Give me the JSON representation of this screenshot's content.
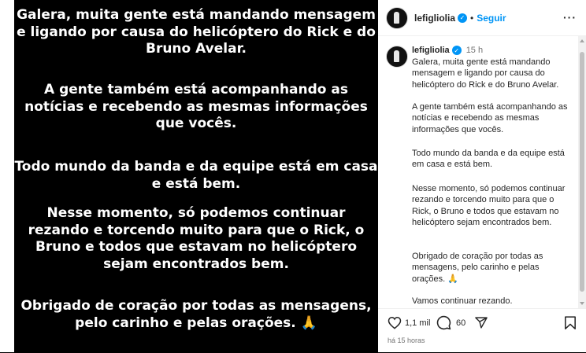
{
  "story": {
    "paragraphs": [
      "Galera, muita gente está mandando mensagem e ligando por causa do helicóptero do Rick e do Bruno Avelar.",
      "A gente também está acompanhando as notícias e recebendo as mesmas informações que vocês.",
      "Todo mundo da banda e da equipe está em casa e está bem.",
      "Nesse momento, só podemos continuar rezando e torcendo muito para que o Rick, o Bruno e todos que estavam no helicóptero sejam encontrados bem.",
      "Obrigado de coração por todas as mensagens, pelo carinho e pelas orações. 🙏"
    ]
  },
  "post": {
    "username": "lefigliolia",
    "follow_label": "Seguir",
    "separator": "•",
    "more_label": "···",
    "caption_time": "15 h",
    "caption": [
      "Galera, muita gente está mandando mensagem e ligando por causa do helicóptero do Rick e do Bruno Avelar.",
      "A gente também está acompanhando as notícias e recebendo as mesmas informações que vocês.",
      "Todo mundo da banda e da equipe está em casa e está bem.",
      "Nesse momento, só podemos continuar rezando e torcendo muito para que o Rick, o Bruno e todos que estavam no helicóptero sejam encontrados bem.",
      "Obrigado de coração por todas as mensagens, pelo carinho e pelas orações. 🙏",
      "Vamos continuar rezando."
    ],
    "likes": "1,1 mil",
    "comments": "60",
    "posted_ago": "há 15 horas"
  },
  "icons": {
    "verified": "verified-badge-icon",
    "like": "heart-icon",
    "comment": "comment-icon",
    "share": "share-icon",
    "save": "bookmark-icon"
  },
  "colors": {
    "story_bg": "#000000",
    "story_text": "#ffffff",
    "link_blue": "#0095f6",
    "muted": "#737373"
  }
}
